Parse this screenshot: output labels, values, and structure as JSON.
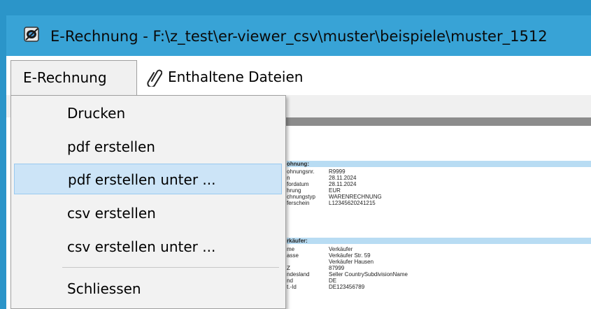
{
  "window": {
    "title": "E-Rechnung - F:\\z_test\\er-viewer_csv\\muster\\beispiele\\muster_1512",
    "app_icon": "app-icon"
  },
  "menubar": {
    "menu_rechnung": "E-Rechnung",
    "menu_dateien": "Enthaltene Dateien",
    "menu_dateien_icon": "paperclip-icon"
  },
  "dropdown": {
    "items": [
      {
        "label": "Drucken"
      },
      {
        "label": "pdf erstellen"
      },
      {
        "label": "pdf erstellen unter ..."
      },
      {
        "label": "csv erstellen"
      },
      {
        "label": "csv erstellen unter ..."
      },
      {
        "label": "Schliessen"
      }
    ],
    "highlighted": "pdf erstellen unter ..."
  },
  "document": {
    "section1": {
      "title": "ohnung:",
      "rows": [
        {
          "k": "ohnungsnr.",
          "v": "R9999"
        },
        {
          "k": "n",
          "v": "28.11.2024"
        },
        {
          "k": "fordatum",
          "v": "28.11.2024"
        },
        {
          "k": "hrung",
          "v": "EUR"
        },
        {
          "k": "chnungstyp",
          "v": "WARENRECHNUNG"
        },
        {
          "k": "ferschein",
          "v": "L12345620241215"
        }
      ]
    },
    "section2": {
      "title": "rkäufer:",
      "rows": [
        {
          "k": "me",
          "v": "Verkäufer"
        },
        {
          "k": "asse",
          "v": "Verkäufer Str. 59"
        },
        {
          "k": "",
          "v": "Verkäufer Hausen"
        },
        {
          "k": "Z",
          "v": "87999"
        },
        {
          "k": "ndesland",
          "v": "Seller CountrySubdivisionName"
        },
        {
          "k": "nd",
          "v": "DE"
        },
        {
          "k": "t.-Id",
          "v": "DE123456789"
        }
      ]
    }
  }
}
